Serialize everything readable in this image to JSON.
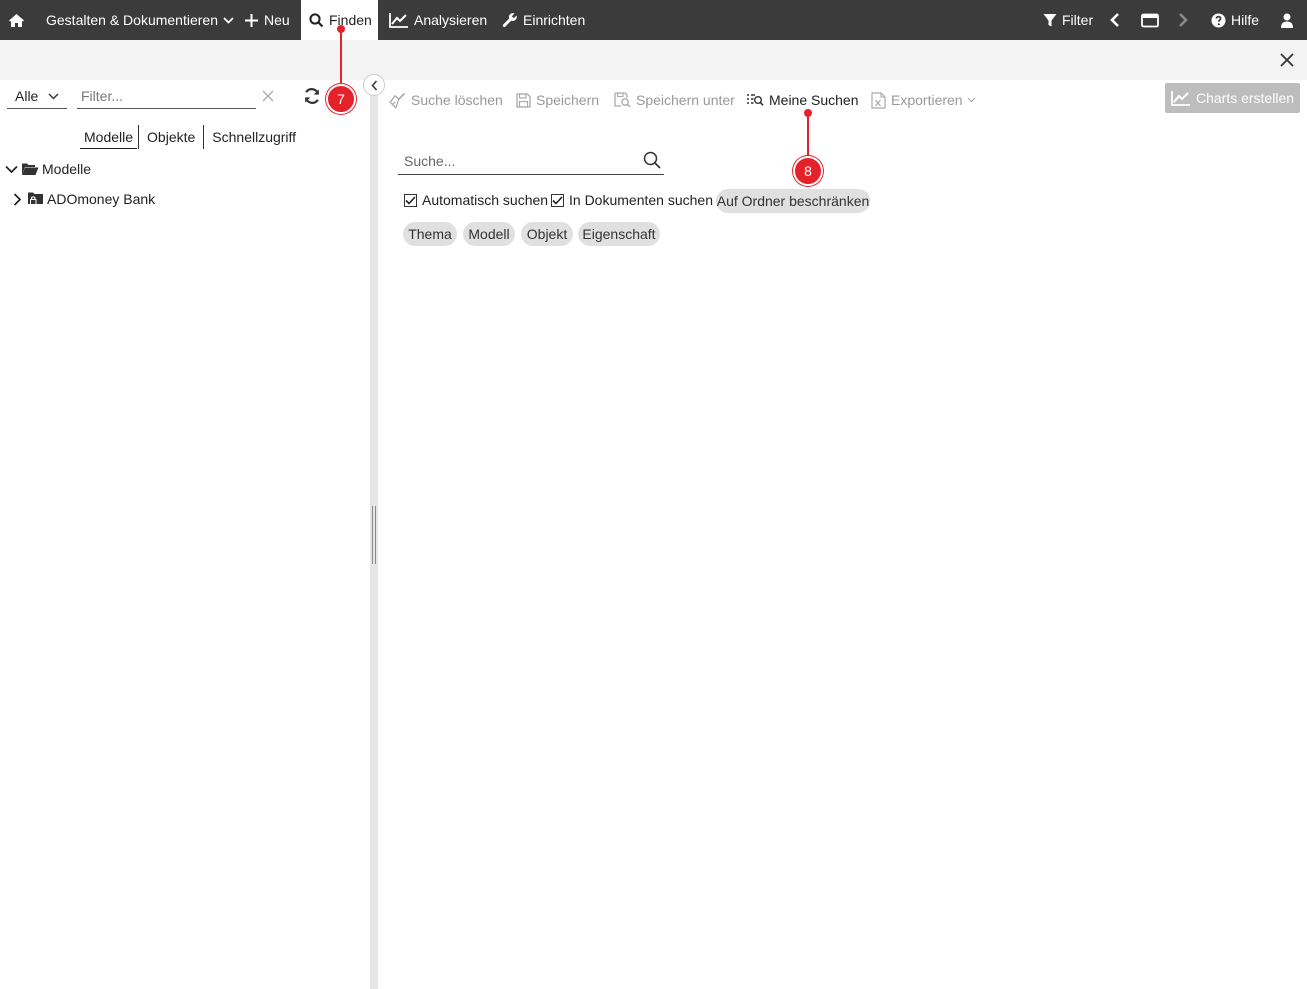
{
  "topbar": {
    "home": "",
    "design": "Gestalten & Dokumentieren",
    "new": "Neu",
    "find": "Finden",
    "analyze": "Analysieren",
    "setup": "Einrichten",
    "filter": "Filter",
    "help": "Hilfe"
  },
  "left": {
    "scope": "Alle",
    "filter_placeholder": "Filter...",
    "tabs": [
      "Modelle",
      "Objekte",
      "Schnellzugriff"
    ],
    "tree": [
      {
        "label": "Modelle",
        "expanded": true
      },
      {
        "label": "ADOmoney Bank",
        "expanded": false
      }
    ]
  },
  "toolbar": {
    "clear_search": "Suche löschen",
    "save": "Speichern",
    "save_as": "Speichern unter",
    "my_searches": "Meine Suchen",
    "export": "Exportieren",
    "charts": "Charts erstellen"
  },
  "search": {
    "placeholder": "Suche...",
    "auto_search": "Automatisch suchen",
    "in_documents": "In Dokumenten suchen",
    "restrict_folder": "Auf Ordner beschränken",
    "chips": [
      "Thema",
      "Modell",
      "Objekt",
      "Eigenschaft"
    ]
  },
  "callouts": [
    "7",
    "8"
  ],
  "colors": {
    "topbar": "#3b3b3b",
    "callout": "#e5222a",
    "disabled_text": "#999999"
  }
}
